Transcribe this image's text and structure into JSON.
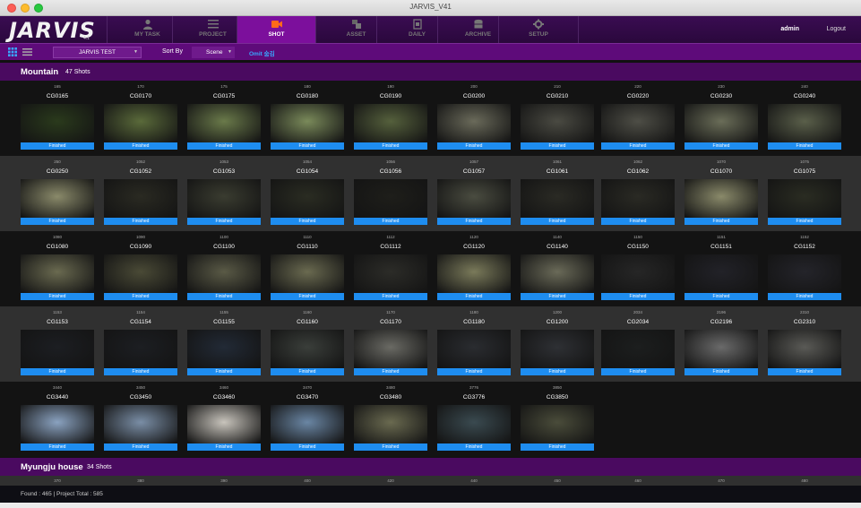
{
  "window": {
    "title": "JARVIS_V41"
  },
  "app": {
    "logo": "JARVIS",
    "version": "4.1"
  },
  "nav": {
    "tabs": [
      {
        "id": "my-task",
        "label": "MY TASK",
        "icon": "person-icon",
        "active": false
      },
      {
        "id": "project",
        "label": "PROJECT",
        "icon": "list-icon",
        "active": false
      },
      {
        "id": "shot",
        "label": "SHOT",
        "icon": "video-camera-icon",
        "active": true
      },
      {
        "id": "asset",
        "label": "ASSET",
        "icon": "asset-icon",
        "active": false
      },
      {
        "id": "daily",
        "label": "DAILY",
        "icon": "daily-icon",
        "active": false
      },
      {
        "id": "archive",
        "label": "ARCHIVE",
        "icon": "archive-icon",
        "active": false
      },
      {
        "id": "setup",
        "label": "SETUP",
        "icon": "gear-icon",
        "active": false
      }
    ],
    "user": "admin",
    "logout": "Logout"
  },
  "toolbar": {
    "project": "JARVIS TEST",
    "sort_by_label": "Sort By",
    "sort_value": "Scene",
    "omit_label": "Omit 숨김"
  },
  "groups": [
    {
      "name": "Mountain",
      "count_text": "47 Shots"
    },
    {
      "name": "Myungju house",
      "count_text": "34 Shots"
    }
  ],
  "status_label": "Finished",
  "colors": {
    "accent": "#7c0f9c",
    "toolbar": "#5e0b7a",
    "status": "#1e8df0",
    "omit": "#39a8ff"
  },
  "rows": [
    [
      {
        "seq": "165",
        "code": "CG0165"
      },
      {
        "seq": "170",
        "code": "CG0170"
      },
      {
        "seq": "175",
        "code": "CG0175"
      },
      {
        "seq": "180",
        "code": "CG0180"
      },
      {
        "seq": "190",
        "code": "CG0190"
      },
      {
        "seq": "200",
        "code": "CG0200"
      },
      {
        "seq": "210",
        "code": "CG0210"
      },
      {
        "seq": "220",
        "code": "CG0220"
      },
      {
        "seq": "230",
        "code": "CG0230"
      },
      {
        "seq": "240",
        "code": "CG0240"
      }
    ],
    [
      {
        "seq": "250",
        "code": "CG0250"
      },
      {
        "seq": "1052",
        "code": "CG1052"
      },
      {
        "seq": "1053",
        "code": "CG1053"
      },
      {
        "seq": "1054",
        "code": "CG1054"
      },
      {
        "seq": "1056",
        "code": "CG1056"
      },
      {
        "seq": "1057",
        "code": "CG1057"
      },
      {
        "seq": "1061",
        "code": "CG1061"
      },
      {
        "seq": "1062",
        "code": "CG1062"
      },
      {
        "seq": "1070",
        "code": "CG1070"
      },
      {
        "seq": "1075",
        "code": "CG1075"
      }
    ],
    [
      {
        "seq": "1080",
        "code": "CG1080"
      },
      {
        "seq": "1090",
        "code": "CG1090"
      },
      {
        "seq": "1100",
        "code": "CG1100"
      },
      {
        "seq": "1110",
        "code": "CG1110"
      },
      {
        "seq": "1112",
        "code": "CG1112"
      },
      {
        "seq": "1120",
        "code": "CG1120"
      },
      {
        "seq": "1140",
        "code": "CG1140"
      },
      {
        "seq": "1150",
        "code": "CG1150"
      },
      {
        "seq": "1151",
        "code": "CG1151"
      },
      {
        "seq": "1152",
        "code": "CG1152"
      }
    ],
    [
      {
        "seq": "1153",
        "code": "CG1153"
      },
      {
        "seq": "1154",
        "code": "CG1154"
      },
      {
        "seq": "1155",
        "code": "CG1155"
      },
      {
        "seq": "1160",
        "code": "CG1160"
      },
      {
        "seq": "1170",
        "code": "CG1170"
      },
      {
        "seq": "1180",
        "code": "CG1180"
      },
      {
        "seq": "1200",
        "code": "CG1200"
      },
      {
        "seq": "2034",
        "code": "CG2034"
      },
      {
        "seq": "2196",
        "code": "CG2196"
      },
      {
        "seq": "2310",
        "code": "CG2310"
      }
    ],
    [
      {
        "seq": "3440",
        "code": "CG3440"
      },
      {
        "seq": "3450",
        "code": "CG3450"
      },
      {
        "seq": "3460",
        "code": "CG3460"
      },
      {
        "seq": "3470",
        "code": "CG3470"
      },
      {
        "seq": "3480",
        "code": "CG3480"
      },
      {
        "seq": "3776",
        "code": "CG3776"
      },
      {
        "seq": "3850",
        "code": "CG3850"
      }
    ]
  ],
  "next_group_seqs": [
    "370",
    "380",
    "390",
    "400",
    "420",
    "440",
    "450",
    "460",
    "470",
    "480"
  ],
  "footer": {
    "found_text": "Found : 465   |   Project Total : 585"
  }
}
